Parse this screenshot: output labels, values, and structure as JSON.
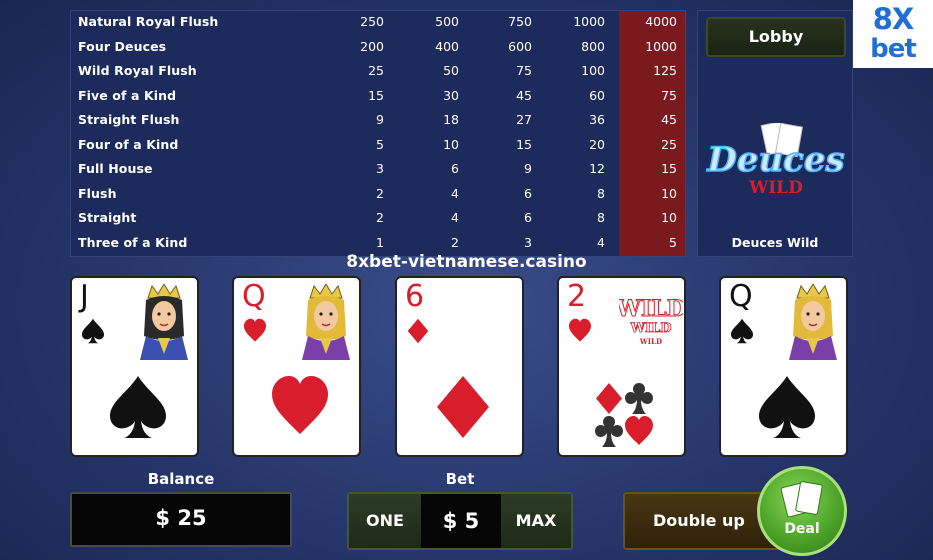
{
  "paytable": {
    "rows": [
      {
        "hand": "Natural Royal Flush",
        "pays": [
          "250",
          "500",
          "750",
          "1000",
          "4000"
        ]
      },
      {
        "hand": "Four Deuces",
        "pays": [
          "200",
          "400",
          "600",
          "800",
          "1000"
        ]
      },
      {
        "hand": "Wild Royal Flush",
        "pays": [
          "25",
          "50",
          "75",
          "100",
          "125"
        ]
      },
      {
        "hand": "Five of a Kind",
        "pays": [
          "15",
          "30",
          "45",
          "60",
          "75"
        ]
      },
      {
        "hand": "Straight Flush",
        "pays": [
          "9",
          "18",
          "27",
          "36",
          "45"
        ]
      },
      {
        "hand": "Four of a Kind",
        "pays": [
          "5",
          "10",
          "15",
          "20",
          "25"
        ]
      },
      {
        "hand": "Full House",
        "pays": [
          "3",
          "6",
          "9",
          "12",
          "15"
        ]
      },
      {
        "hand": "Flush",
        "pays": [
          "2",
          "4",
          "6",
          "8",
          "10"
        ]
      },
      {
        "hand": "Straight",
        "pays": [
          "2",
          "4",
          "6",
          "8",
          "10"
        ]
      },
      {
        "hand": "Three of a Kind",
        "pays": [
          "1",
          "2",
          "3",
          "4",
          "5"
        ]
      }
    ],
    "highlight_color": "#7a1a1f"
  },
  "side": {
    "lobby_label": "Lobby",
    "logo_title": "Deuces",
    "logo_sub": "WILD",
    "game_name": "Deuces Wild"
  },
  "brand": {
    "top": "8X",
    "bottom": "bet"
  },
  "watermark": "8xbet-vietnamese.casino",
  "cards": [
    {
      "rank": "J",
      "suit": "spade",
      "color": "black",
      "face": "jack"
    },
    {
      "rank": "Q",
      "suit": "heart",
      "color": "red",
      "face": "queen"
    },
    {
      "rank": "6",
      "suit": "diamond",
      "color": "red",
      "face": ""
    },
    {
      "rank": "2",
      "suit": "heart",
      "color": "red",
      "face": "wild",
      "wild_text": [
        "WILD",
        "WILD",
        "WILD"
      ]
    },
    {
      "rank": "Q",
      "suit": "spade",
      "color": "black",
      "face": "queen"
    }
  ],
  "controls": {
    "balance_label": "Balance",
    "balance_value": "$ 25",
    "bet_label": "Bet",
    "bet_one": "ONE",
    "bet_value": "$ 5",
    "bet_max": "MAX",
    "double_up": "Double up",
    "deal": "Deal"
  },
  "colors": {
    "background": "#26366b",
    "panel": "#1d2a5c",
    "suit_red": "#d81e2c",
    "deal_green": "#4ea52a",
    "brand_blue": "#1f6fd6"
  }
}
